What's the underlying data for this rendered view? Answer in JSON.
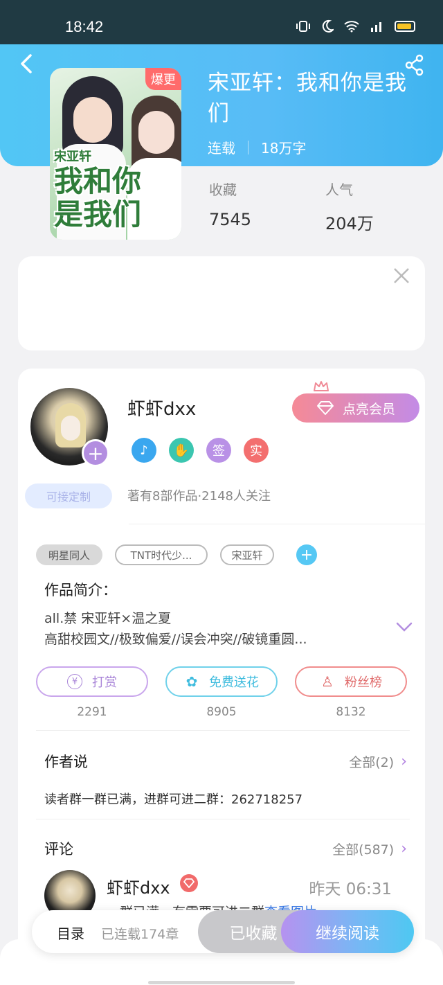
{
  "status_bar": {
    "time": "18:42"
  },
  "book": {
    "title": "宋亚轩：我和你是我们",
    "cover_badge": "爆更",
    "status": "连载",
    "word_count": "18万字",
    "cover_title_lines": [
      "宋亚轩",
      "我和你",
      "是我们"
    ],
    "stats": [
      {
        "label": "收藏",
        "value": "7545"
      },
      {
        "label": "人气",
        "value": "204万"
      }
    ]
  },
  "author": {
    "name": "虾虾dxx",
    "custom_tag": "可接定制",
    "works_info": "著有8部作品·2148人关注",
    "vip_button": "点亮会员",
    "badges": [
      {
        "icon": "music-note-icon",
        "label": ""
      },
      {
        "icon": "handshake-icon",
        "label": ""
      },
      {
        "icon": "sign-badge-icon",
        "label": "签"
      },
      {
        "icon": "verified-badge-icon",
        "label": "实"
      }
    ]
  },
  "tags": [
    "明星同人",
    "TNT时代少...",
    "宋亚轩"
  ],
  "intro": {
    "title": "作品简介：",
    "line1": "all.禁  宋亚轩×温之夏",
    "line2": "高甜校园文//极致偏爱//误会冲突//破镜重圆..."
  },
  "actions": [
    {
      "label": "打赏",
      "icon_char": "¥",
      "count": "2291"
    },
    {
      "label": "免费送花",
      "icon_char": "✿",
      "count": "8905"
    },
    {
      "label": "粉丝榜",
      "icon_char": "♙",
      "count": "8132"
    }
  ],
  "author_says": {
    "title": "作者说",
    "more": "全部(2)",
    "text": "读者群一群已满，进群可进二群：262718257"
  },
  "comments": {
    "title": "评论",
    "more": "全部(587)",
    "first": {
      "name": "虾虾dxx",
      "time": "昨天 06:31",
      "text": "一群已满，有需要可进二群",
      "link": "查看图片"
    }
  },
  "bottom_bar": {
    "catalog": "目录",
    "serial_info": "已连载174章",
    "favorited": "已收藏",
    "continue": "继续阅读"
  },
  "colors": {
    "header": "#52c6f5",
    "accent_purple": "#b38ee0",
    "accent_cyan": "#4ec8f2",
    "accent_red": "#f16a6a"
  }
}
